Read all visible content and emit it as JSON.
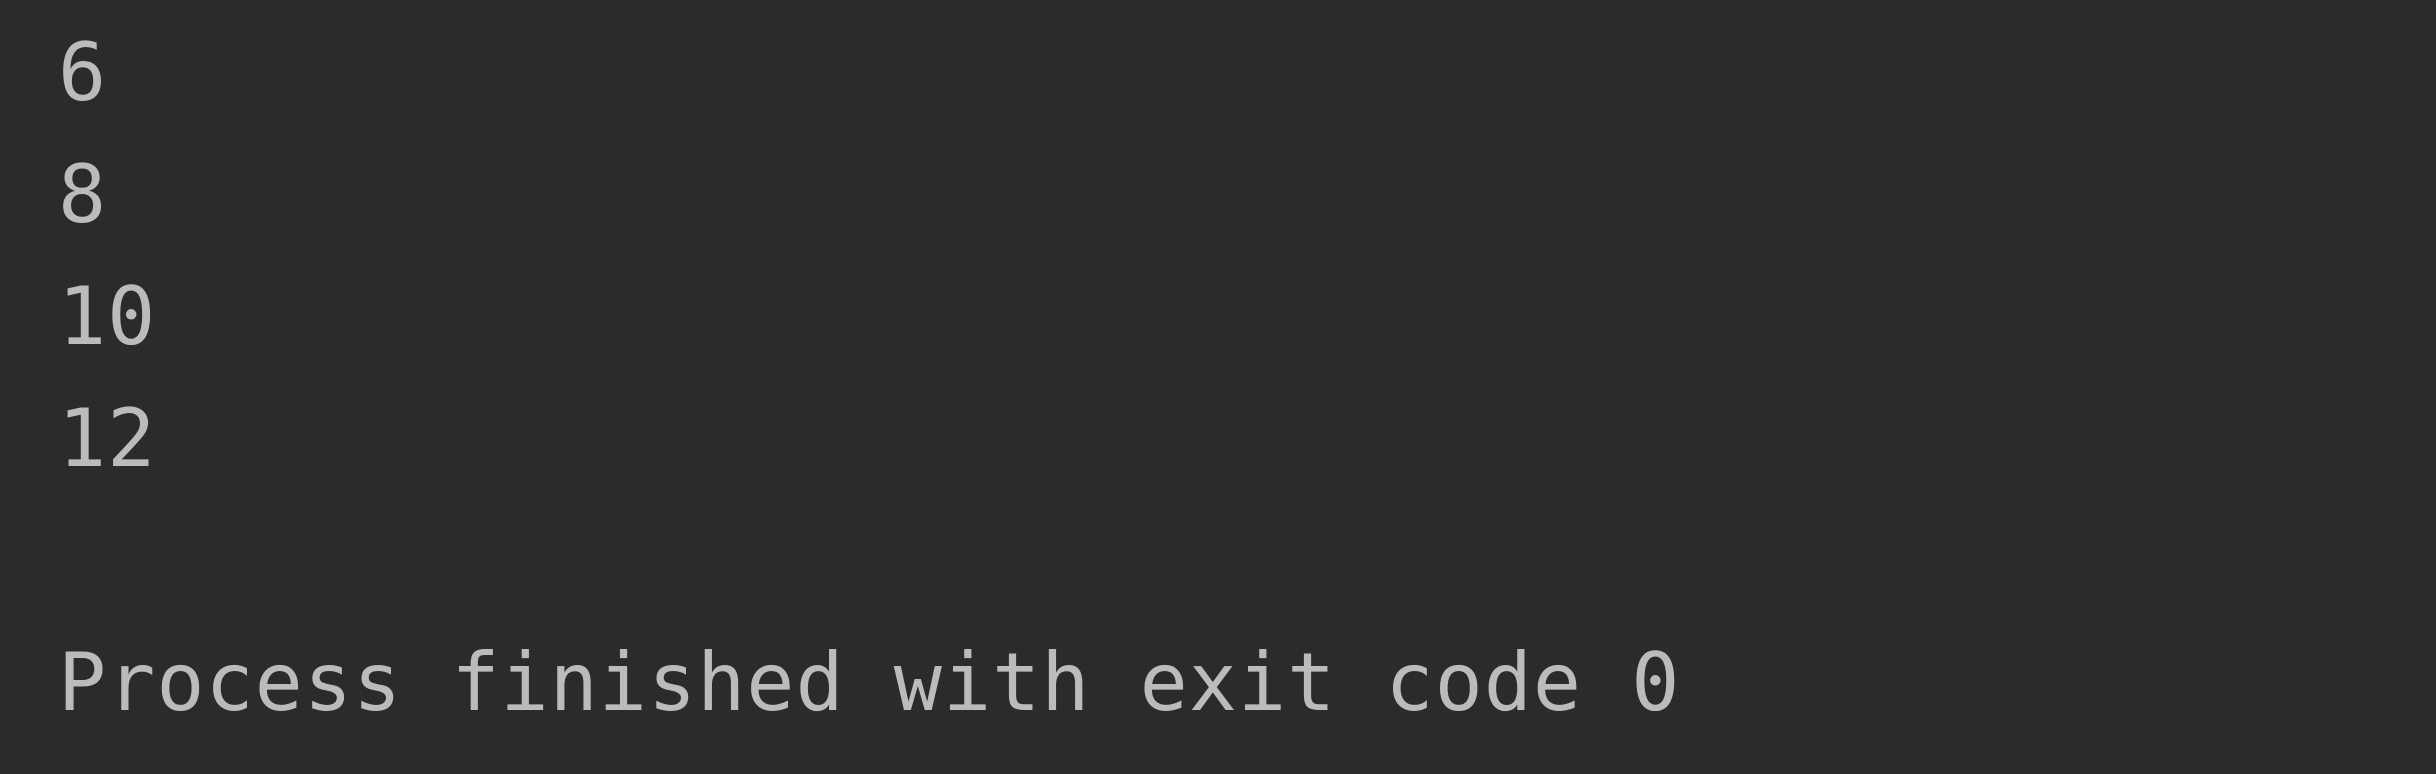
{
  "console": {
    "output_lines": [
      "6",
      "8",
      "10",
      "12"
    ],
    "exit_message": "Process finished with exit code 0"
  },
  "colors": {
    "background": "#2b2b2b",
    "text": "#bbbbbb"
  }
}
